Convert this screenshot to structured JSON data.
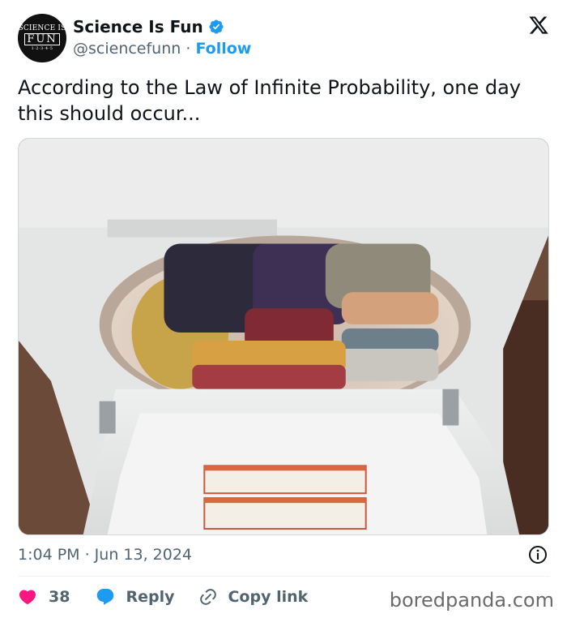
{
  "author": {
    "display_name": "Science Is Fun",
    "handle": "@sciencefunn",
    "separator": "·",
    "follow_label": "Follow",
    "avatar": {
      "line1": "SCIENCE IS",
      "line2": "FUN",
      "line3": "1·2·3·4·5"
    },
    "verified_icon": "verified-badge-icon",
    "verified_color": "#1d9bf0"
  },
  "platform_icon": "x-logo-icon",
  "tweet": {
    "text": "According to the Law of Infinite Probability, one day this should occur...",
    "image_alt": "Photo of an open top-loading washing machine with folded laundry stacked inside the drum"
  },
  "timestamp": "1:04 PM · Jun 13, 2024",
  "actions": {
    "like_count": "38",
    "reply_label": "Reply",
    "copy_label": "Copy link",
    "like_color": "#f91880",
    "reply_color": "#1d9bf0"
  },
  "watermark": "boredpanda.com"
}
